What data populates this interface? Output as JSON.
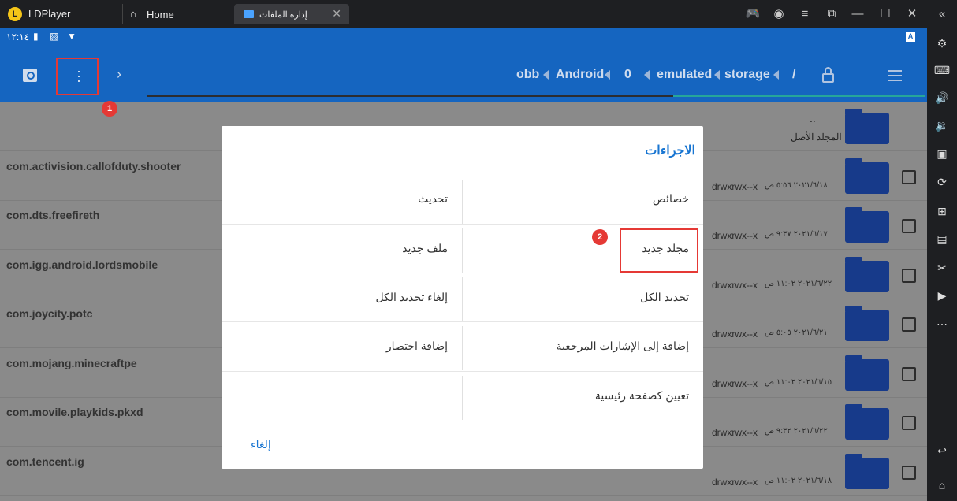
{
  "window": {
    "app_name": "LDPlayer",
    "tabs": [
      {
        "label": "Home",
        "icon": "home-icon"
      },
      {
        "label": "إدارة الملفات",
        "icon": "folder-icon",
        "active": true
      }
    ],
    "controls": [
      "gamepad-icon",
      "account-icon",
      "menu-icon",
      "popout-icon",
      "minimize-icon",
      "maximize-icon",
      "close-icon",
      "collapse-icon"
    ]
  },
  "statusbar": {
    "time": "١٢:١٤",
    "keyboard_indicator": "A"
  },
  "toolbar": {
    "breadcrumb": [
      "/",
      "storage",
      "emulated",
      "0",
      "Android",
      "obb"
    ]
  },
  "badges": {
    "first": "1",
    "second": "2"
  },
  "parent_folder": {
    "dots": "..",
    "label": "المجلد الأصل"
  },
  "files": [
    {
      "name": "com.activision.callofduty.shooter",
      "perm": "drwxrwx--x",
      "date": "٢٠٢١/٦/١٨ ٥:٥٦ ص"
    },
    {
      "name": "com.dts.freefireth",
      "perm": "drwxrwx--x",
      "date": "٢٠٢١/٦/١٧ ٩:٣٧ ص"
    },
    {
      "name": "com.igg.android.lordsmobile",
      "perm": "drwxrwx--x",
      "date": "٢٠٢١/٦/٢٢ ١١:٠٢ ص"
    },
    {
      "name": "com.joycity.potc",
      "perm": "drwxrwx--x",
      "date": "٢٠٢١/٦/٢١ ٥:٠٥ ص"
    },
    {
      "name": "com.mojang.minecraftpe",
      "perm": "drwxrwx--x",
      "date": "٢٠٢١/٦/١٥ ١١:٠٢ ص"
    },
    {
      "name": "com.movile.playkids.pkxd",
      "perm": "drwxrwx--x",
      "date": "٢٠٢١/٦/٢٢ ٩:٣٢ ص"
    },
    {
      "name": "com.tencent.ig",
      "perm": "drwxrwx--x",
      "date": "٢٠٢١/٦/١٨ ١١:٠٢ ص"
    }
  ],
  "dialog": {
    "title": "الاجراءات",
    "options": {
      "properties": "خصائص",
      "refresh": "تحديث",
      "new_folder": "مجلد جديد",
      "new_file": "ملف جديد",
      "select_all": "تحديد الكل",
      "deselect_all": "إلغاء تحديد الكل",
      "add_bookmark": "إضافة إلى الإشارات المرجعية",
      "add_shortcut": "إضافة اختصار",
      "set_home": "تعيين كصفحة رئيسية"
    },
    "cancel": "إلغاء"
  },
  "colors": {
    "accent": "#1565c0",
    "highlight": "#e53935",
    "dialog_title": "#1976d2"
  }
}
